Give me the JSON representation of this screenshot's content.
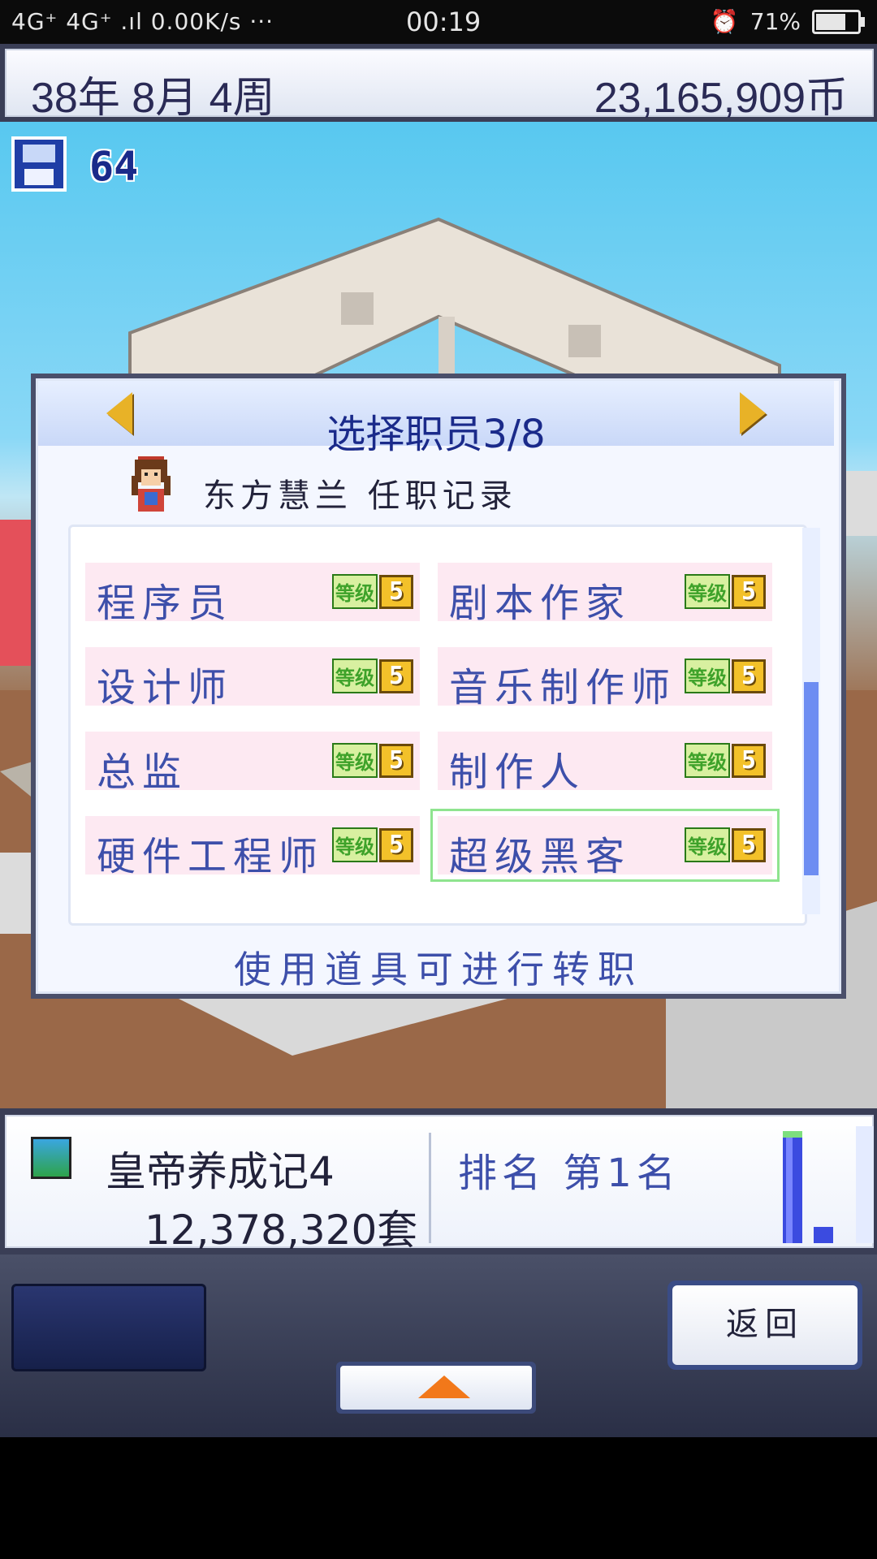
{
  "status_bar": {
    "network": "4G⁺ 4G⁺ .ıl 0.00K/s ···",
    "time": "00:19",
    "battery": "71%"
  },
  "top_bar": {
    "date": "38年 8月 4周",
    "money": "23,165,909币"
  },
  "world": {
    "save_count": "64"
  },
  "dialog": {
    "title": "选择职员3/8",
    "employee_name": "东方慧兰 任职记录",
    "level_label": "等级",
    "jobs": [
      {
        "name": "程序员",
        "level": "5"
      },
      {
        "name": "剧本作家",
        "level": "5"
      },
      {
        "name": "设计师",
        "level": "5"
      },
      {
        "name": "音乐制作师",
        "level": "5"
      },
      {
        "name": "总监",
        "level": "5"
      },
      {
        "name": "制作人",
        "level": "5"
      },
      {
        "name": "硬件工程师",
        "level": "5"
      },
      {
        "name": "超级黑客",
        "level": "5"
      }
    ],
    "hint": "使用道具可进行转职"
  },
  "info_panel": {
    "game_name": "皇帝养成记4",
    "sales": "12,378,320套",
    "rank": "排名 第1名"
  },
  "controls": {
    "back_label": "返回"
  },
  "colors": {
    "accent_blue": "#3d4faa",
    "level_gold": "#f3c12a",
    "selected_outline": "#8fe48f"
  }
}
